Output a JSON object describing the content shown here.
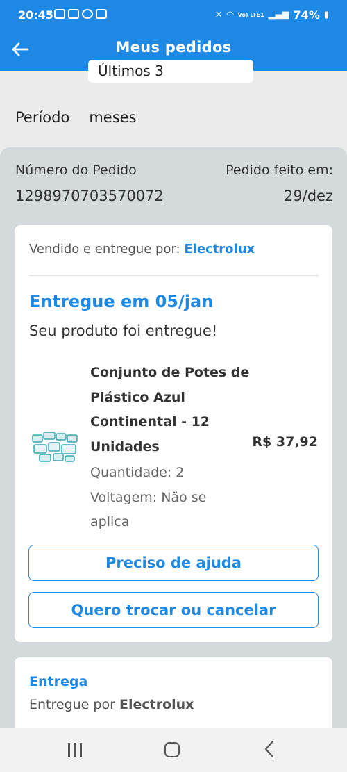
{
  "status_bar": {
    "time": "20:45",
    "battery": "74%",
    "network": "Vo) LTE1"
  },
  "app_bar": {
    "title": "Meus pedidos",
    "back_icon": "arrow-left-icon"
  },
  "filter": {
    "chip_text": "Últimos 3",
    "periodo_label": "Período",
    "periodo_value": "meses"
  },
  "order": {
    "number_label": "Número do Pedido",
    "number_value": "1298970703570072",
    "date_label": "Pedido feito em:",
    "date_value": "29/dez"
  },
  "item_card": {
    "seller_prefix": "Vendido e entregue por:",
    "seller_name": "Electrolux",
    "delivered_title": "Entregue em 05/jan",
    "delivered_sub": "Seu produto foi entregue!",
    "product_name": "Conjunto de Potes de Plástico Azul Continental - 12 Unidades",
    "price": "R$ 37,92",
    "quantity": "Quantidade: 2",
    "voltage": "Voltagem: Não se aplica",
    "help_button": "Preciso de ajuda",
    "exchange_button": "Quero trocar ou cancelar"
  },
  "delivery_card": {
    "title": "Entrega",
    "text_prefix": "Entregue por",
    "text_company": "Electrolux"
  },
  "colors": {
    "primary": "#1e88e5",
    "panel": "#d4d9dc",
    "background": "#ececec"
  }
}
